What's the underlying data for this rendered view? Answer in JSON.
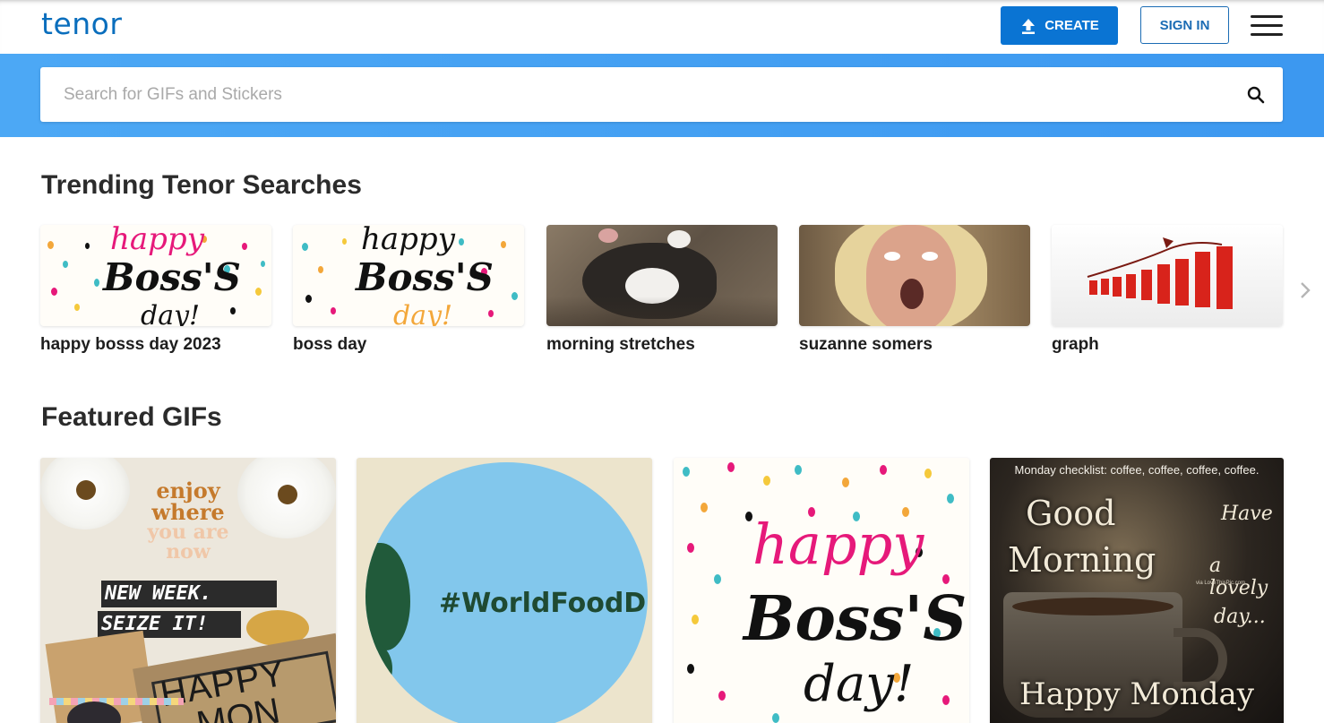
{
  "header": {
    "logo": "tenor",
    "create_label": "CREATE",
    "signin_label": "SIGN IN"
  },
  "search": {
    "placeholder": "Search for GIFs and Stickers"
  },
  "trending": {
    "title": "Trending Tenor Searches",
    "items": [
      {
        "label": "happy bosss day 2023"
      },
      {
        "label": "boss day"
      },
      {
        "label": "morning stretches"
      },
      {
        "label": "suzanne somers"
      },
      {
        "label": "graph"
      }
    ]
  },
  "featured": {
    "title": "Featured GIFs",
    "gif1": {
      "enjoy": "enjoy",
      "where": "where",
      "you_are": "you are",
      "now": "now",
      "new_week": "NEW WEEK.",
      "seize_it": "SEIZE IT!",
      "happy": "HAPPY",
      "mon": "MON"
    },
    "gif2": {
      "text": "#WorldFoodD"
    },
    "gif3": {
      "happy": "happy",
      "boss": "Boss'S",
      "day": "day!"
    },
    "gif4": {
      "checklist": "Monday checklist: coffee, coffee, coffee, coffee.",
      "good": "Good",
      "morning": "Morning",
      "have": "Have",
      "a_lovely": "a lovely",
      "day": "day...",
      "watermark": "via LoveThisPic.com",
      "happy_monday": "Happy Monday"
    }
  },
  "thumbs": {
    "t1": {
      "happy": "happy",
      "boss": "Boss'S",
      "day": "day!"
    },
    "t2": {
      "happy": "happy",
      "boss": "Boss'S",
      "day": "day!"
    }
  },
  "colors": {
    "brand": "#0a6ebd",
    "create_bg": "#0a74d3",
    "search_band": "#4ca8f5",
    "pink": "#e6197a"
  }
}
